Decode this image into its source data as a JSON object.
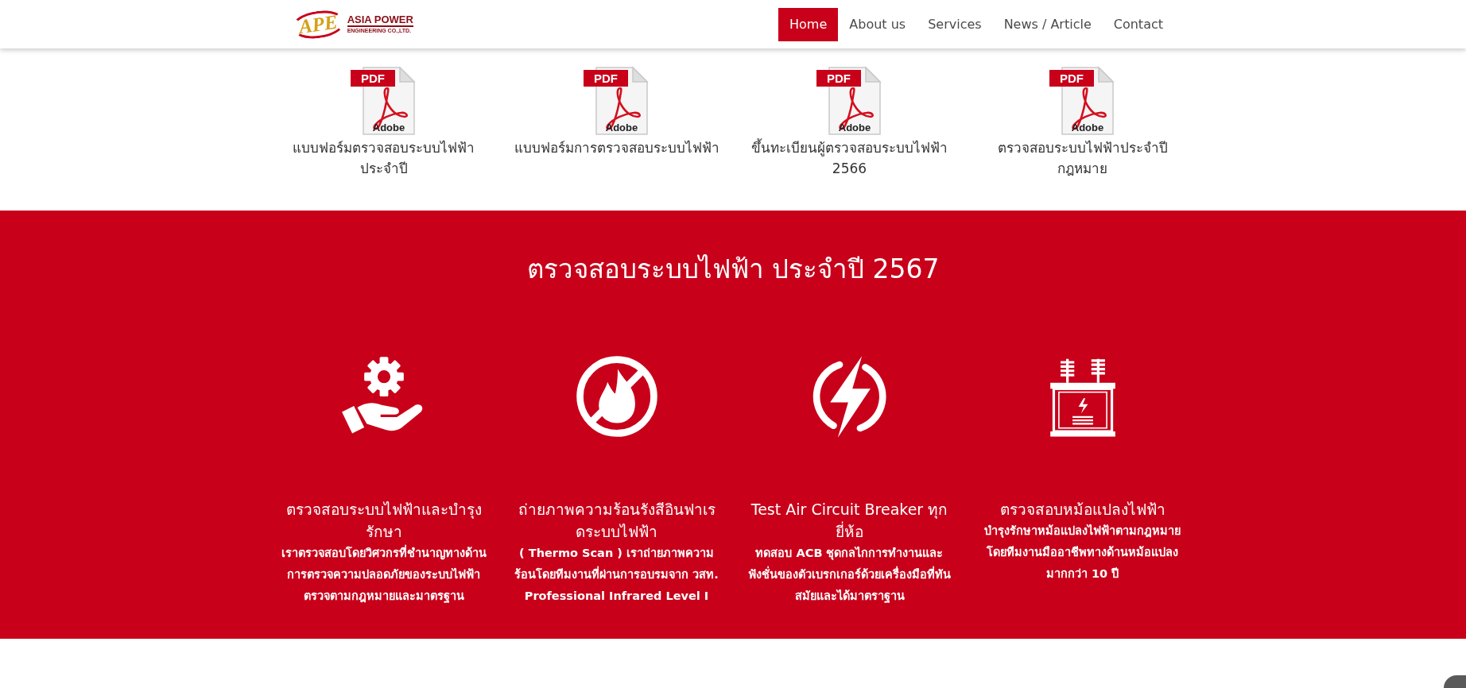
{
  "header": {
    "logo": {
      "initials": "APE",
      "name": "ASIA POWER",
      "subtitle": "ENGINEERING CO.,LTD."
    },
    "nav": [
      {
        "label": "Home",
        "selected": true
      },
      {
        "label": "About us",
        "selected": false
      },
      {
        "label": "Services",
        "selected": false
      },
      {
        "label": "News / Article",
        "selected": false
      },
      {
        "label": "Contact",
        "selected": false
      }
    ]
  },
  "documents": [
    {
      "label": "แบบฟอร์มตรวจสอบระบบไฟฟ้า ประจำปี",
      "file_type": "PDF",
      "brand": "Adobe"
    },
    {
      "label": "แบบฟอร์มการตรวจสอบระบบไฟฟ้า",
      "file_type": "PDF",
      "brand": "Adobe"
    },
    {
      "label": "ขึ้นทะเบียนผู้ตรวจสอบระบบไฟฟ้า 2566",
      "file_type": "PDF",
      "brand": "Adobe"
    },
    {
      "label": "ตรวจสอบระบบไฟฟ้าประจำปี กฎหมาย",
      "file_type": "PDF",
      "brand": "Adobe"
    }
  ],
  "services": {
    "title": "ตรวจสอบระบบไฟฟ้า ประจำปี 2567",
    "items": [
      {
        "kind": "maintenance",
        "heading": "ตรวจสอบระบบไฟฟ้าและบำรุงรักษา",
        "description": "เราตรวจสอบโดยวิศวกรที่ชำนาญทางด้านการตรวจความปลอดภัยของระบบไฟฟ้า ตรวจตามกฎหมายและมาตรฐาน"
      },
      {
        "kind": "no-fire",
        "heading": "ถ่ายภาพความร้อนรังสีอินฟาเรดระบบไฟฟ้า",
        "description": "( Thermo Scan ) เราถ่ายภาพความร้อนโดยทีมงานที่ผ่านการอบรมจาก วสท. Professional Infrared Level I"
      },
      {
        "kind": "power",
        "heading": "Test Air Circuit Breaker ทุกยี่ห้อ",
        "description": "ทดสอบ ACB ชุดกลไกการทำงานและฟังชั่นของตัวเบรกเกอร์ด้วยเครื่องมือที่ทันสมัยและได้มาตราฐาน"
      },
      {
        "kind": "transformer",
        "heading": "ตรวจสอบหม้อแปลงไฟฟ้า",
        "description": "บำรุงรักษาหม้อแปลงไฟฟ้าตามกฎหมายโดยทีมงานมืออาชีพทางด้านหม้อแปลงมากกว่า 10 ปี"
      }
    ]
  }
}
